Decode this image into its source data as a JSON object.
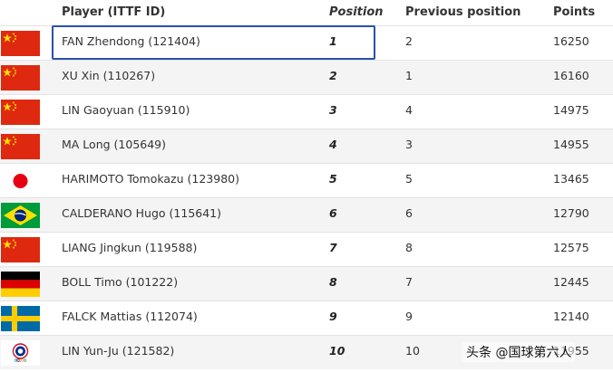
{
  "header": {
    "player": "Player (ITTF ID)",
    "position": "Position",
    "previous": "Previous position",
    "points": "Points"
  },
  "rows": [
    {
      "flag": "china-flag-icon",
      "player": "FAN Zhendong (121404)",
      "position": "1",
      "previous": "2",
      "points": "16250"
    },
    {
      "flag": "china-flag-icon",
      "player": "XU Xin (110267)",
      "position": "2",
      "previous": "1",
      "points": "16160"
    },
    {
      "flag": "china-flag-icon",
      "player": "LIN Gaoyuan (115910)",
      "position": "3",
      "previous": "4",
      "points": "14975"
    },
    {
      "flag": "china-flag-icon",
      "player": "MA Long (105649)",
      "position": "4",
      "previous": "3",
      "points": "14955"
    },
    {
      "flag": "japan-flag-icon",
      "player": "HARIMOTO Tomokazu (123980)",
      "position": "5",
      "previous": "5",
      "points": "13465"
    },
    {
      "flag": "brazil-flag-icon",
      "player": "CALDERANO Hugo (115641)",
      "position": "6",
      "previous": "6",
      "points": "12790"
    },
    {
      "flag": "china-flag-icon",
      "player": "LIANG Jingkun (119588)",
      "position": "7",
      "previous": "8",
      "points": "12575"
    },
    {
      "flag": "germany-flag-icon",
      "player": "BOLL Timo (101222)",
      "position": "8",
      "previous": "7",
      "points": "12445"
    },
    {
      "flag": "sweden-flag-icon",
      "player": "FALCK Mattias (112074)",
      "position": "9",
      "previous": "9",
      "points": "12140"
    },
    {
      "flag": "chinese-taipei-olympic-flag-icon",
      "player": "LIN Yun-Ju (121582)",
      "position": "10",
      "previous": "10",
      "points": "11955"
    }
  ],
  "colors": {
    "highlight_border": "#2a52a8",
    "row_alt": "#f4f4f4",
    "china_red": "#de2910",
    "china_star": "#ffde00"
  },
  "watermark": "头条 @国球第六人"
}
